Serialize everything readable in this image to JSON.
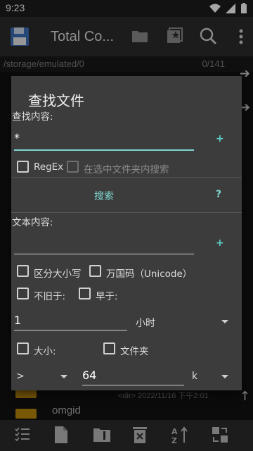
{
  "status_bar": {
    "time": "9:23"
  },
  "app_bar": {
    "title": "Total Co..."
  },
  "path_bar": {
    "path": "/storage/emulated/0",
    "count": "0/141"
  },
  "background_list": {
    "row_info": "<dir>  2022/11/16  下午2:01",
    "row_name": "omgid"
  },
  "dialog": {
    "title": "查找文件",
    "search_label": "查找内容:",
    "search_value": "*",
    "regex_label": "RegEx",
    "in_selected_label": "在选中文件夹内搜索",
    "search_button": "搜索",
    "help_button": "?",
    "text_content_label": "文本内容:",
    "text_content_value": "",
    "case_sensitive_label": "区分大小写",
    "unicode_label": "万国码（Unicode）",
    "not_older_label": "不旧于:",
    "older_label": "早于:",
    "age_value": "1",
    "age_unit": "小时",
    "size_label": "大小:",
    "folder_label": "文件夹",
    "size_compare": ">",
    "size_value": "64",
    "size_unit": "k",
    "plus": "+"
  },
  "icons": {
    "save": "floppy-icon",
    "folder": "folder-icon",
    "star": "star-icon",
    "search": "search-icon",
    "menu": "more-vert-icon",
    "bottom": [
      "checklist-icon",
      "file-icon",
      "zip-icon",
      "delete-icon",
      "sort-az-icon",
      "swap-icon"
    ]
  },
  "colors": {
    "accent": "#7ed7d0",
    "dialog_bg": "#3c3c3c",
    "appbar": "#2b2b2b"
  }
}
